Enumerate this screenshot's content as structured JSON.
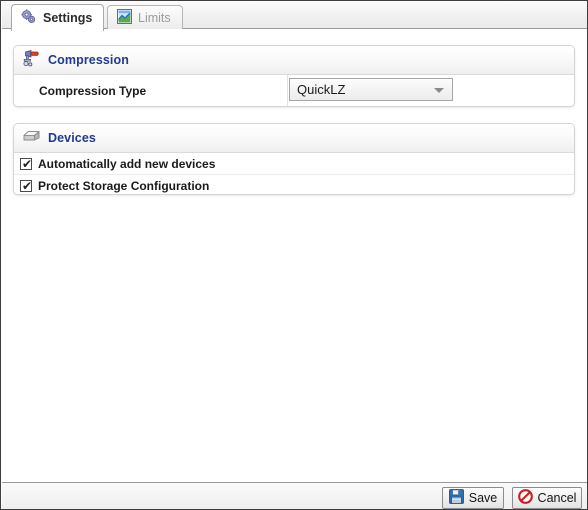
{
  "window": {
    "title": "Settings"
  },
  "tabs": [
    {
      "label": "Settings",
      "icon": "gears-icon",
      "active": true
    },
    {
      "label": "Limits",
      "icon": "chart-icon",
      "active": false
    }
  ],
  "sections": [
    {
      "key": "compression",
      "title": "Compression",
      "icon": "compressor-icon",
      "fields": [
        {
          "label": "Compression Type",
          "control": "dropdown",
          "value": "QuickLZ",
          "options": [
            "QuickLZ"
          ]
        }
      ]
    },
    {
      "key": "devices",
      "title": "Devices",
      "icon": "hard-drive-icon",
      "checkboxes": [
        {
          "label": "Automatically add new devices",
          "checked": true,
          "mark": "✔"
        },
        {
          "label": "Protect Storage Configuration",
          "checked": true,
          "mark": "✔"
        }
      ]
    }
  ],
  "footer": {
    "save_label": "Save",
    "save_icon": "floppy-disk-icon",
    "cancel_label": "Cancel",
    "cancel_icon": "no-entry-icon"
  },
  "colors": {
    "section_title": "#1f3a93",
    "window_border": "#3d3d3d",
    "panel_border": "#d4d4d4",
    "inactive_tab_text": "#9b9b9b",
    "save_icon_blue": "#2f6fb5",
    "cancel_icon_red": "#cc1f22"
  }
}
